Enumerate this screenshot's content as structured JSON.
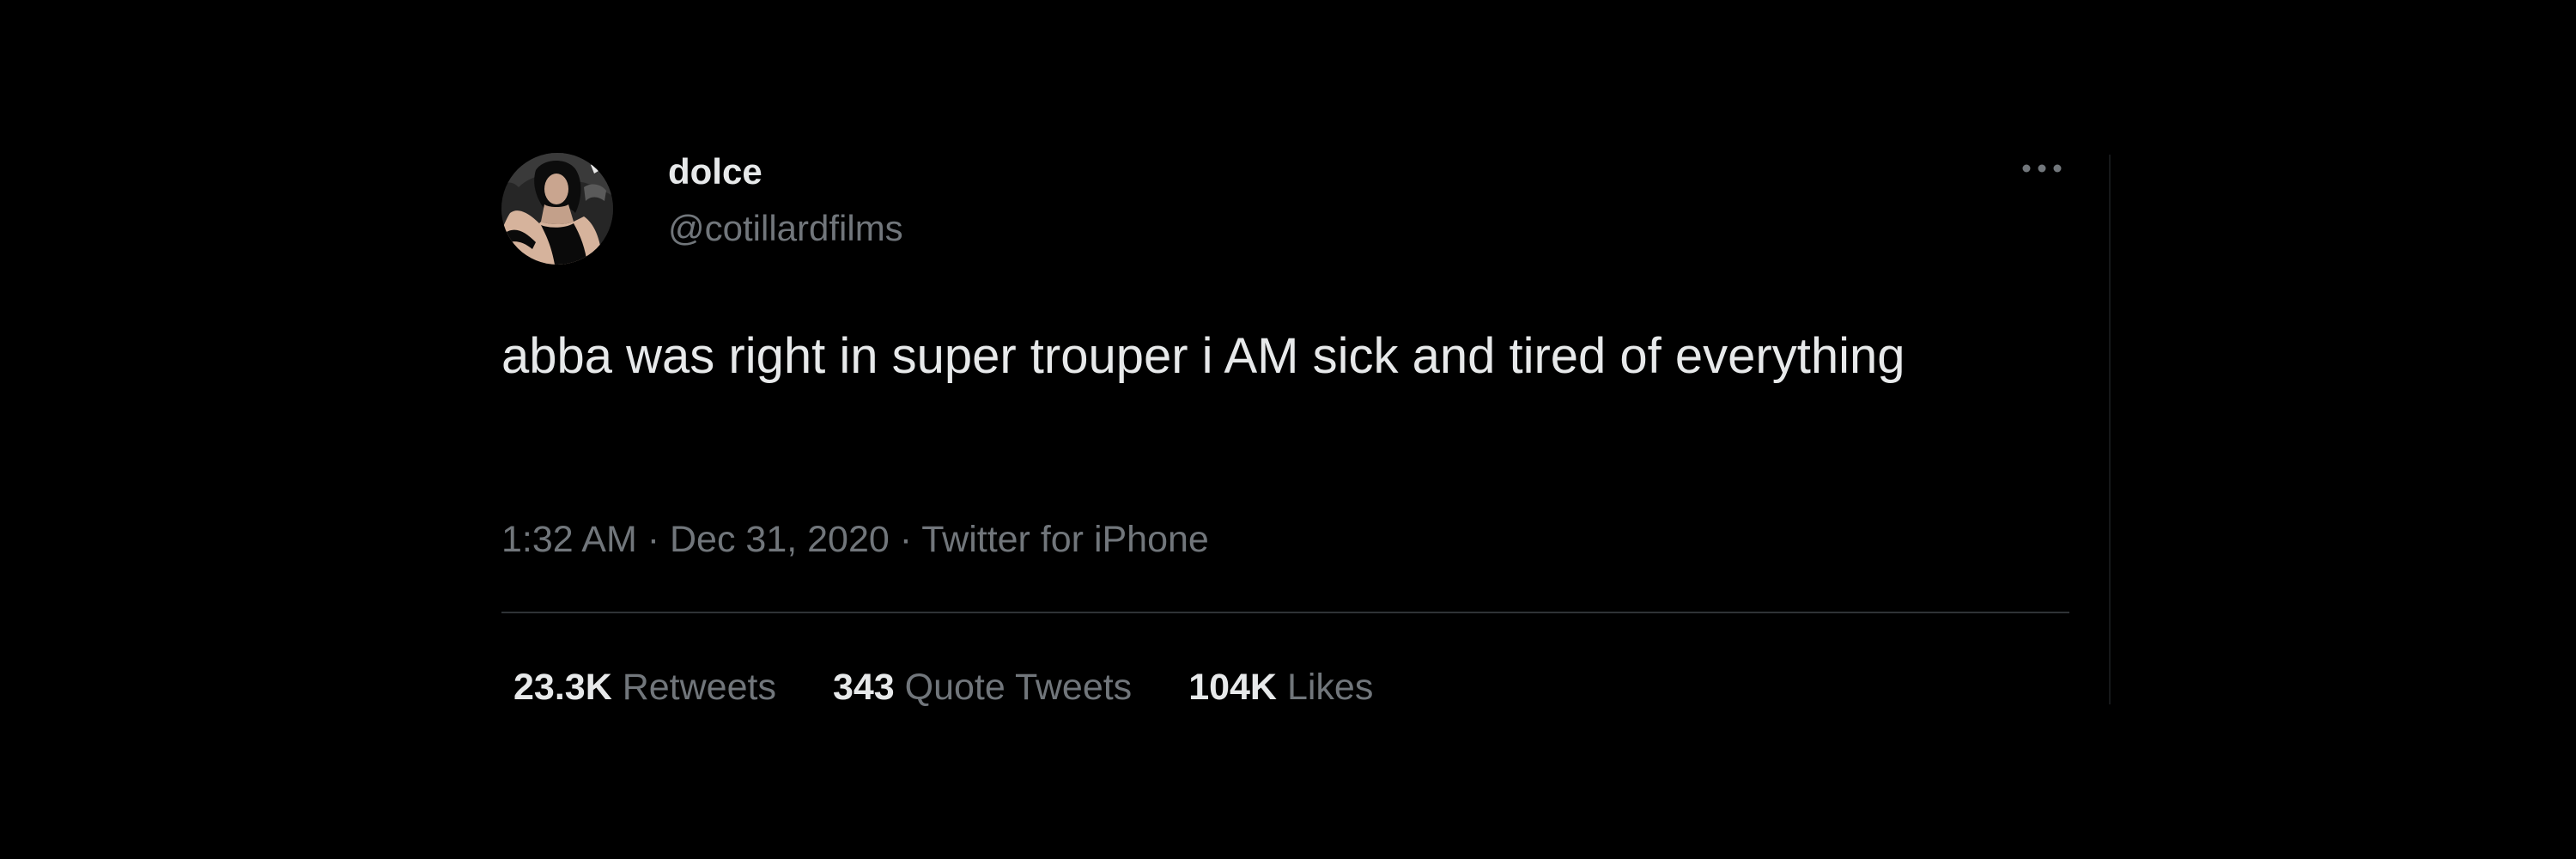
{
  "tweet": {
    "author": {
      "display_name": "dolce",
      "handle": "@cotillardfilms"
    },
    "text": "abba was right in super trouper i AM sick and tired of everything",
    "meta": {
      "time": "1:32 AM",
      "separator": "·",
      "date": "Dec 31, 2020",
      "source": "Twitter for iPhone"
    },
    "stats": [
      {
        "count": "23.3K",
        "label": "Retweets"
      },
      {
        "count": "343",
        "label": "Quote Tweets"
      },
      {
        "count": "104K",
        "label": "Likes"
      }
    ],
    "icons": {
      "more": "more-horizontal-icon"
    }
  }
}
